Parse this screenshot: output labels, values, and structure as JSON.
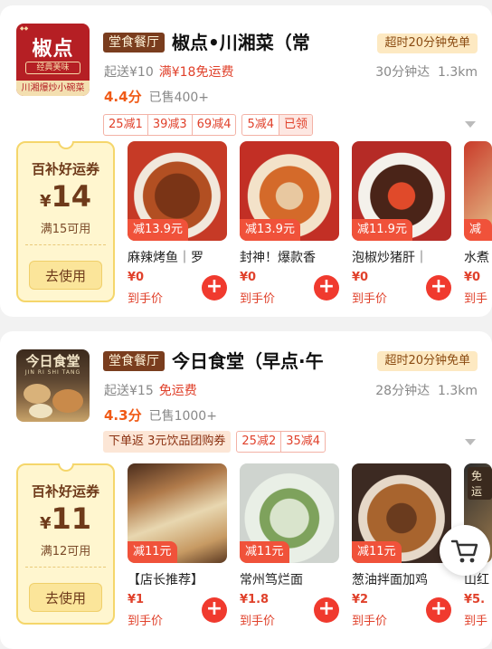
{
  "shops": [
    {
      "logo": {
        "main": "椒点",
        "tagline": "经典美味",
        "bottom": "川湘爆炒小碗菜"
      },
      "type_tag": "堂食餐厅",
      "name": "椒点•川湘菜（常",
      "badge": "超时20分钟免单",
      "min_order": "起送¥10",
      "delivery_fee": "满¥18免运费",
      "eta": "30分钟达",
      "distance": "1.3km",
      "rating": "4.4分",
      "sold": "已售400+",
      "promos": [
        {
          "items": [
            "25减1",
            "39减3",
            "69减4"
          ]
        },
        {
          "items": [
            "5减4",
            "已领"
          ]
        }
      ],
      "coupon": {
        "title": "百补好运券",
        "currency": "¥",
        "amount": "14",
        "condition": "满15可用",
        "button": "去使用"
      },
      "dishes": [
        {
          "discount": "减13.9元",
          "name": "麻辣烤鱼｜罗",
          "price": "¥0",
          "net": "到手价"
        },
        {
          "discount": "减13.9元",
          "name": "封神！爆款香",
          "price": "¥0",
          "net": "到手价"
        },
        {
          "discount": "减11.9元",
          "name": "泡椒炒猪肝｜",
          "price": "¥0",
          "net": "到手价"
        },
        {
          "discount": "减1",
          "name": "水煮",
          "price": "¥0",
          "net": "到手"
        }
      ]
    },
    {
      "logo": {
        "main": "今日食堂",
        "sub": "JIN RI SHI TANG"
      },
      "type_tag": "堂食餐厅",
      "name": "今日食堂（早点·午",
      "badge": "超时20分钟免单",
      "min_order": "起送¥15",
      "delivery_fee": "免运费",
      "eta": "28分钟达",
      "distance": "1.3km",
      "rating": "4.3分",
      "sold": "已售1000+",
      "promo_fill": "下单返  3元饮品团购券",
      "promos": [
        {
          "items": [
            "25减2",
            "35减4"
          ]
        }
      ],
      "coupon": {
        "title": "百补好运券",
        "currency": "¥",
        "amount": "11",
        "condition": "满12可用",
        "button": "去使用"
      },
      "dishes": [
        {
          "discount": "减11元",
          "name": "【店长推荐】",
          "price": "¥1",
          "net": "到手价"
        },
        {
          "discount": "减11元",
          "name": "常州笃烂面",
          "price": "¥1.8",
          "net": "到手价"
        },
        {
          "discount": "减11元",
          "name": "葱油拌面加鸡",
          "price": "¥2",
          "net": "到手价"
        },
        {
          "discount": "",
          "edge_tag": "免运",
          "name": "山红",
          "price": "¥5.",
          "net": "到手"
        }
      ]
    }
  ],
  "icons": {
    "cart": "shopping-cart-icon",
    "add": "plus-icon",
    "expand": "chevron-down-icon"
  }
}
